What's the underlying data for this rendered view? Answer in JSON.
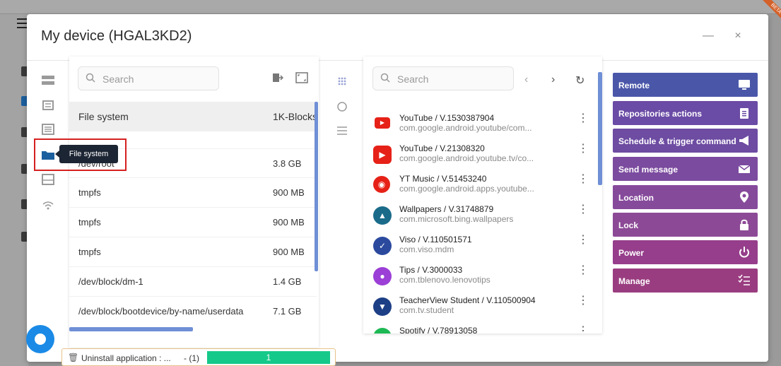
{
  "colors": {
    "remote": "#4a57a9",
    "repositories": "#6a4ba5",
    "schedule": "#6d4ca2",
    "send_message": "#7b4b9f",
    "location": "#864a9b",
    "lock": "#8c4a96",
    "power": "#963e8b",
    "manage": "#9a3d80",
    "progress": "#15c98a",
    "tooltip_bg": "#1c2533",
    "highlight_border": "#d62020"
  },
  "modal": {
    "title": "My device (HGAL3KD2)",
    "minimize": "—",
    "close": "×"
  },
  "rail": {
    "icons": [
      "server-icon",
      "message-icon",
      "list-icon",
      "folder-icon",
      "layout-icon",
      "wifi-icon"
    ]
  },
  "tooltip": {
    "label": "File system"
  },
  "fs": {
    "search_placeholder": "Search",
    "headers": {
      "name": "File system",
      "size": "1K-Blocks"
    },
    "rows": [
      {
        "name": "/dev/root",
        "size": "3.8 GB"
      },
      {
        "name": "tmpfs",
        "size": "900 MB"
      },
      {
        "name": "tmpfs",
        "size": "900 MB"
      },
      {
        "name": "tmpfs",
        "size": "900 MB"
      },
      {
        "name": "/dev/block/dm-1",
        "size": "1.4 GB"
      },
      {
        "name": "/dev/block/bootdevice/by-name/userdata",
        "size": "7.1 GB"
      }
    ]
  },
  "apps": {
    "search_placeholder": "Search",
    "prev": "‹",
    "next": "›",
    "refresh": "↻",
    "items": [
      {
        "title": "YouTube / V.1530387904",
        "pkg": "com.google.android.youtube/com...",
        "icon": "youtube-icon",
        "color": "#e62117"
      },
      {
        "title": "YouTube / V.21308320",
        "pkg": "com.google.android.youtube.tv/co...",
        "icon": "youtube-tv-icon",
        "color": "#e62117"
      },
      {
        "title": "YT Music / V.51453240",
        "pkg": "com.google.android.apps.youtube...",
        "icon": "yt-music-icon",
        "color": "#e62117"
      },
      {
        "title": "Wallpapers / V.31748879",
        "pkg": "com.microsoft.bing.wallpapers",
        "icon": "wallpapers-icon",
        "color": "#1a6b8a"
      },
      {
        "title": "Viso / V.110501571",
        "pkg": "com.viso.mdm",
        "icon": "viso-icon",
        "color": "#2b4a9e"
      },
      {
        "title": "Tips / V.3000033",
        "pkg": "com.tblenovo.lenovotips",
        "icon": "tips-icon",
        "color": "#9b3fd6"
      },
      {
        "title": "TeacherView Student / V.110500904",
        "pkg": "com.tv.student",
        "icon": "teacherview-icon",
        "color": "#1d3f86"
      },
      {
        "title": "Spotify / V.78913058",
        "pkg": "",
        "icon": "spotify-icon",
        "color": "#1db954"
      }
    ]
  },
  "actions": [
    {
      "label": "Remote",
      "icon": "monitor-icon",
      "glyph": "▭"
    },
    {
      "label": "Repositories actions",
      "icon": "clipboard-icon",
      "glyph": "▤"
    },
    {
      "label": "Schedule & trigger command",
      "icon": "megaphone-icon",
      "glyph": "◀"
    },
    {
      "label": "Send message",
      "icon": "envelope-icon",
      "glyph": "✉"
    },
    {
      "label": "Location",
      "icon": "location-pin-icon",
      "glyph": "●"
    },
    {
      "label": "Lock",
      "icon": "lock-icon",
      "glyph": "▲"
    },
    {
      "label": "Power",
      "icon": "power-icon",
      "glyph": "⏻"
    },
    {
      "label": "Manage",
      "icon": "checklist-icon",
      "glyph": "☰"
    }
  ],
  "toast": {
    "label": "Uninstall application : ...",
    "count": "- (1)",
    "progress_value": "1"
  }
}
